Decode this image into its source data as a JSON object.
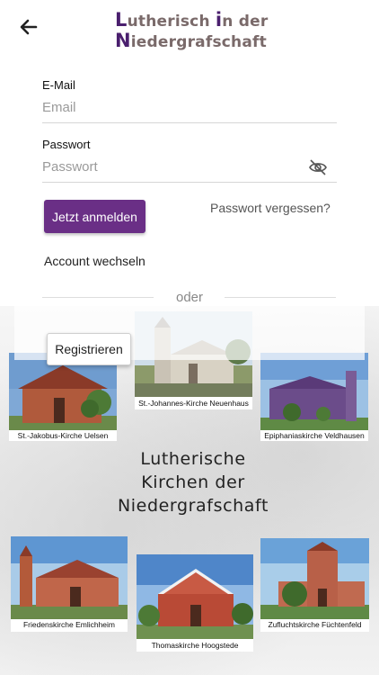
{
  "header": {
    "back_icon": "arrow-left-icon",
    "logo_cap_1": "L",
    "logo_line1": "utherisch ",
    "logo_cap_2": "i",
    "logo_line1_end": "n der",
    "logo_cap_3": "N",
    "logo_line2": "iedergrafschaft"
  },
  "form": {
    "email_label": "E-Mail",
    "email_placeholder": "Email",
    "password_label": "Passwort",
    "password_placeholder": "Passwort",
    "password_toggle_icon": "eye-off-icon",
    "login_button": "Jetzt anmelden",
    "forgot_link": "Passwort vergessen?",
    "switch_account": "Account wechseln",
    "separator": "oder",
    "register_button": "Registrieren"
  },
  "colors": {
    "primary": "#6a2f86",
    "logo_accent": "#4a1f6e"
  },
  "churches": [
    {
      "caption": "St.-Jakobus-Kirche Uelsen"
    },
    {
      "caption": "St.-Johannes-Kirche Neuenhaus"
    },
    {
      "caption": "Epiphaniaskirche Veldhausen"
    },
    {
      "caption": "Friedenskirche Emlichheim"
    },
    {
      "caption": "Thomaskirche Hoogstede"
    },
    {
      "caption": "Zufluchtskirche Füchtenfeld"
    }
  ],
  "heading": {
    "line1": "Lutherische",
    "line2": "Kirchen der",
    "line3": "Niedergrafschaft"
  }
}
